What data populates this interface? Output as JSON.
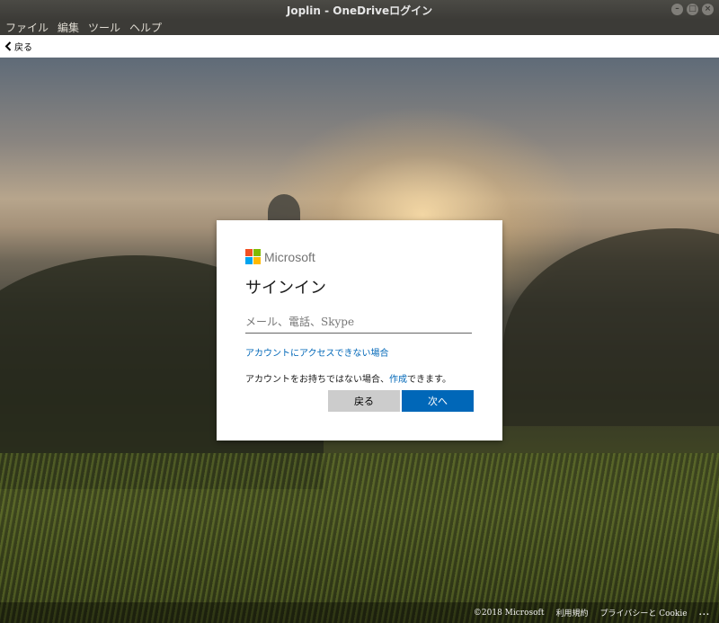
{
  "window": {
    "title": "Joplin - OneDriveログイン"
  },
  "menu": [
    "ファイル",
    "編集",
    "ツール",
    "ヘルプ"
  ],
  "nav": {
    "back_label": "戻る"
  },
  "signin": {
    "brand": "Microsoft",
    "title": "サインイン",
    "email_placeholder": "メール、電話、Skype",
    "cant_access": "アカウントにアクセスできない場合",
    "no_account_prefix": "アカウントをお持ちではない場合、",
    "create_link": "作成",
    "no_account_suffix": "できます。",
    "back_button": "戻る",
    "next_button": "次へ"
  },
  "footer": {
    "copyright": "©2018 Microsoft",
    "terms": "利用規約",
    "privacy": "プライバシーと Cookie",
    "more": "..."
  },
  "colors": {
    "ms_red": "#f25022",
    "ms_green": "#7fba00",
    "ms_blue": "#00a4ef",
    "ms_yellow": "#ffb900",
    "accent": "#0067b8"
  }
}
